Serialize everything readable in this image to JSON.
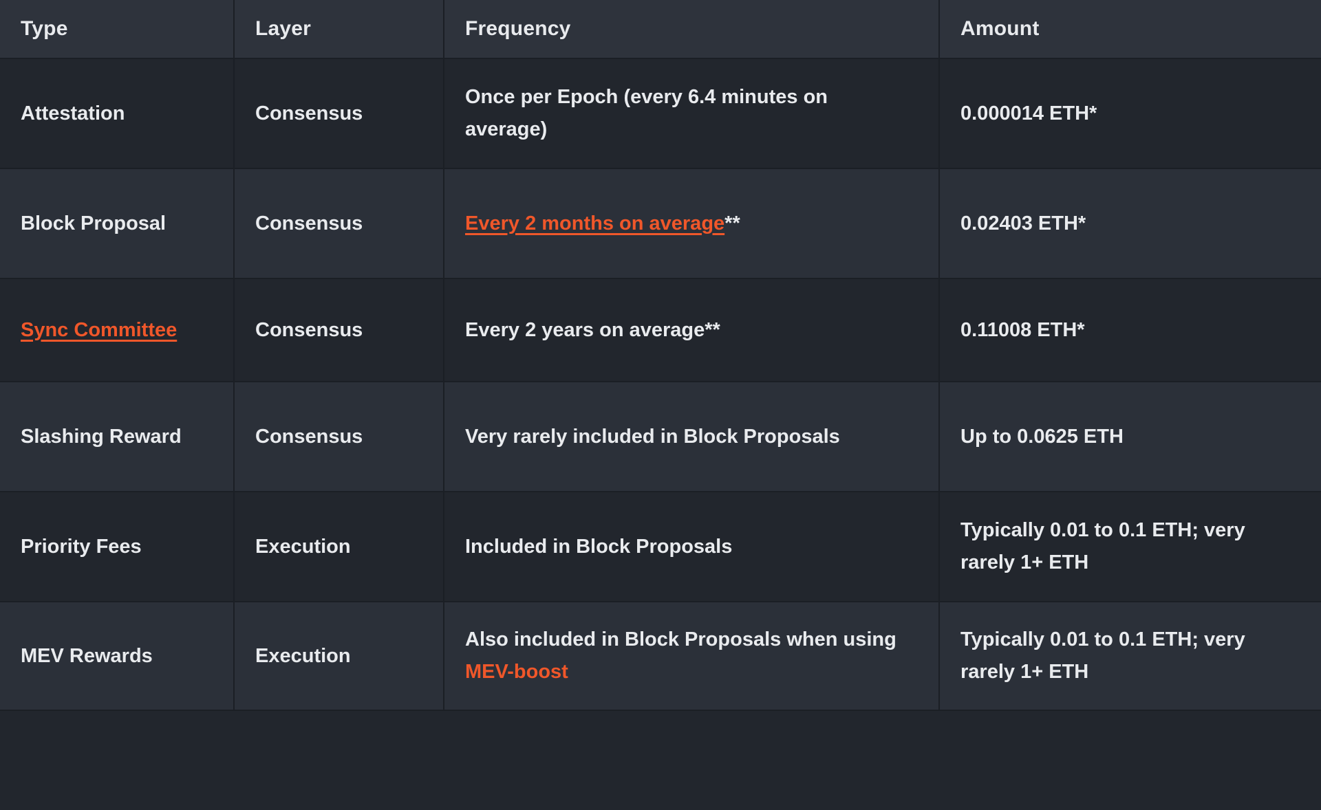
{
  "table": {
    "colors": {
      "header_bg": "#2e333c",
      "row_bg_dark": "#22262d",
      "row_bg_light": "#2b3039",
      "grid_line": "#1b1f25",
      "text": "#e9ebee",
      "link_orange": "#f0572a"
    },
    "columns": [
      {
        "key": "type",
        "label": "Type"
      },
      {
        "key": "layer",
        "label": "Layer"
      },
      {
        "key": "frequency",
        "label": "Frequency"
      },
      {
        "key": "amount",
        "label": "Amount"
      }
    ],
    "rows": [
      {
        "type": "Attestation",
        "type_is_link": false,
        "layer": "Consensus",
        "frequency": "Once per Epoch (every 6.4 minutes on average)",
        "frequency_link_text": "",
        "frequency_suffix": "",
        "frequency_trailing": "",
        "amount": "0.000014 ETH*"
      },
      {
        "type": "Block Proposal",
        "type_is_link": false,
        "layer": "Consensus",
        "frequency": "",
        "frequency_link_text": "Every 2 months on average",
        "frequency_suffix": "**",
        "frequency_trailing": "",
        "amount": "0.02403 ETH*"
      },
      {
        "type": "Sync Committee",
        "type_is_link": true,
        "layer": "Consensus",
        "frequency": "Every 2 years on average**",
        "frequency_link_text": "",
        "frequency_suffix": "",
        "frequency_trailing": "",
        "amount": "0.11008 ETH*"
      },
      {
        "type": "Slashing Reward",
        "type_is_link": false,
        "layer": "Consensus",
        "frequency": "Very rarely included in Block Proposals",
        "frequency_link_text": "",
        "frequency_suffix": "",
        "frequency_trailing": "",
        "amount": "Up to 0.0625 ETH"
      },
      {
        "type": "Priority Fees",
        "type_is_link": false,
        "layer": "Execution",
        "frequency": "Included in Block Proposals",
        "frequency_link_text": "",
        "frequency_suffix": "",
        "frequency_trailing": "",
        "amount": "Typically 0.01 to 0.1 ETH; very rarely 1+ ETH"
      },
      {
        "type": "MEV Rewards",
        "type_is_link": false,
        "layer": "Execution",
        "frequency": "Also included in Block Proposals when using ",
        "frequency_link_text": "MEV-boost",
        "frequency_suffix": "",
        "frequency_trailing": "",
        "amount": "Typically 0.01 to 0.1 ETH; very rarely 1+ ETH"
      }
    ]
  }
}
